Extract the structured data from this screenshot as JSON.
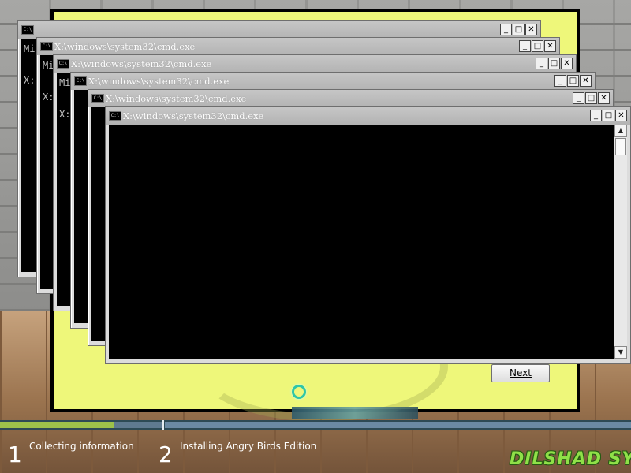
{
  "setup": {
    "next_label": "Next"
  },
  "cmd_windows": [
    {
      "title": "",
      "lines": [
        "Mi",
        "",
        "X:"
      ]
    },
    {
      "title": "X:\\windows\\system32\\cmd.exe",
      "lines": [
        "Mi",
        "",
        "X:"
      ]
    },
    {
      "title": "X:\\windows\\system32\\cmd.exe",
      "lines": [
        "Mi",
        "",
        "X:"
      ]
    },
    {
      "title": "X:\\windows\\system32\\cmd.exe",
      "lines": []
    },
    {
      "title": "X:\\windows\\system32\\cmd.exe",
      "lines": []
    },
    {
      "title": "X:\\windows\\system32\\cmd.exe",
      "lines": []
    }
  ],
  "controls": {
    "minimize": "_",
    "maximize": "□",
    "close": "✕"
  },
  "steps": [
    {
      "number": "1",
      "label": "Collecting information"
    },
    {
      "number": "2",
      "label": "Installing Angry Birds Edition"
    }
  ],
  "progress": {
    "step1_fraction": 0.7
  },
  "brand_text": "DILSHAD SYS",
  "colors": {
    "setup_bg": "#eef77a",
    "progress_fill": "#9dc24a",
    "brand": "#8fe048"
  }
}
